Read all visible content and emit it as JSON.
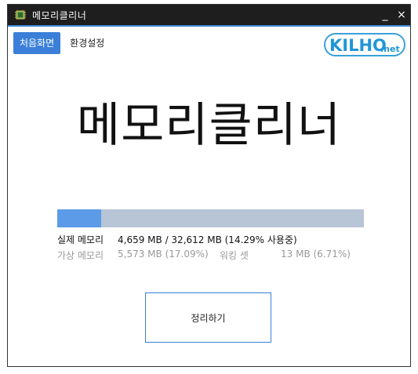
{
  "window": {
    "title": "메모리클리너",
    "app_icon": "memory-chip-icon",
    "controls": {
      "minimize": "_",
      "close": "×"
    }
  },
  "nav": {
    "items": [
      {
        "label": "처음화면",
        "active": true
      },
      {
        "label": "환경설정",
        "active": false
      }
    ]
  },
  "logo": {
    "main": "KILHO",
    "suffix": ".net"
  },
  "main": {
    "title": "메모리클리너"
  },
  "memory": {
    "usage_percent": 14.29,
    "real": {
      "label": "실제 메모리",
      "value": "4,659 MB / 32,612 MB (14.29% 사용중)"
    },
    "virtual": {
      "label": "가상 메모리",
      "value": "5,573 MB (17.09%)"
    },
    "working_set": {
      "label": "워킹 셋",
      "value": "13 MB (6.71%)"
    }
  },
  "actions": {
    "clean_label": "정리하기"
  },
  "colors": {
    "accent": "#3b7fd9",
    "titlebar": "#1e1e1e",
    "bar_fill": "#5b9be8",
    "bar_track": "#b8c5d6"
  }
}
